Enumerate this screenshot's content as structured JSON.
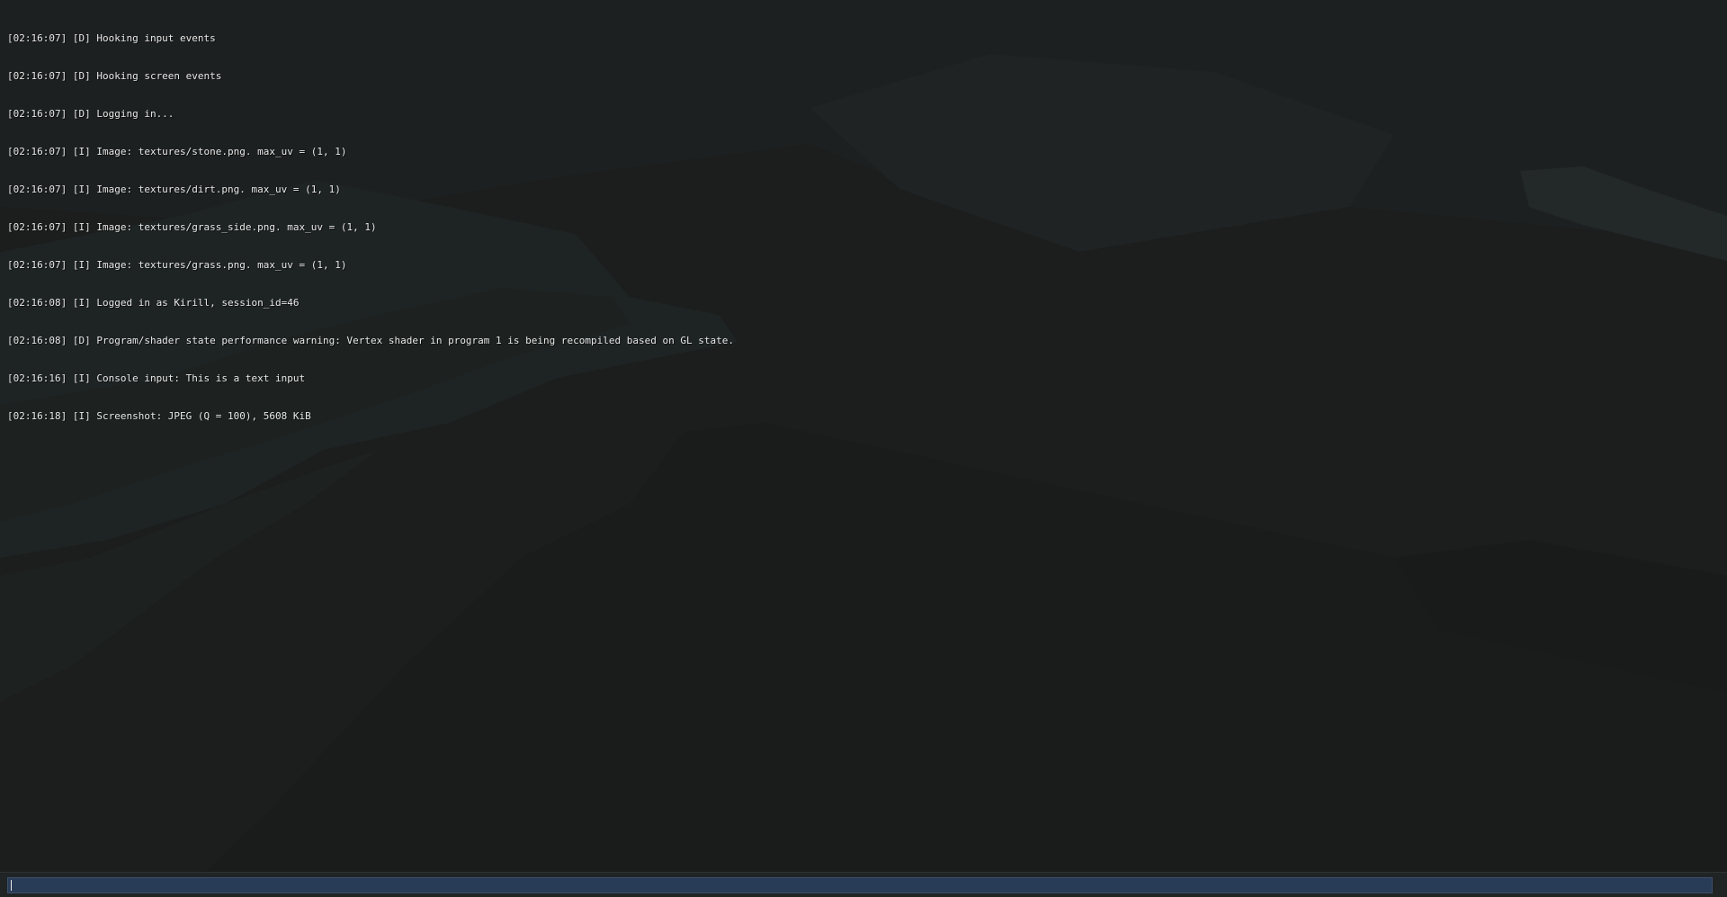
{
  "console": {
    "log_lines": [
      "[02:16:07] [D] Hooking input events",
      "[02:16:07] [D] Hooking screen events",
      "[02:16:07] [D] Logging in...",
      "[02:16:07] [I] Image: textures/stone.png. max_uv = (1, 1)",
      "[02:16:07] [I] Image: textures/dirt.png. max_uv = (1, 1)",
      "[02:16:07] [I] Image: textures/grass_side.png. max_uv = (1, 1)",
      "[02:16:07] [I] Image: textures/grass.png. max_uv = (1, 1)",
      "[02:16:08] [I] Logged in as Kirill, session_id=46",
      "[02:16:08] [D] Program/shader state performance warning: Vertex shader in program 1 is being recompiled based on GL state.",
      "[02:16:16] [I] Console input: This is a text input",
      "[02:16:18] [I] Screenshot: JPEG (Q = 100), 5608 KiB"
    ],
    "input": {
      "value": "",
      "placeholder": ""
    }
  },
  "colors": {
    "background": "#1c1d1d",
    "input_fill": "#283c57",
    "log_text": "#e8e8e8"
  }
}
